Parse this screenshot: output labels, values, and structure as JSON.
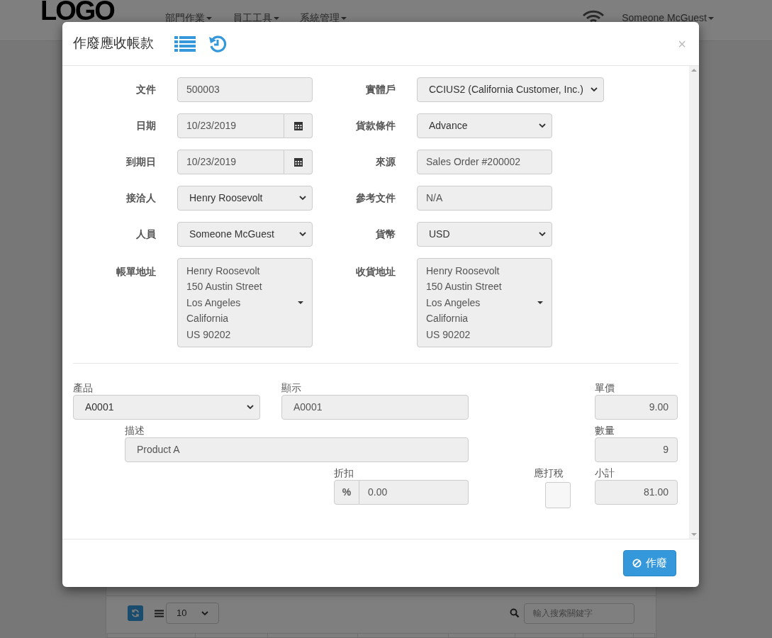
{
  "page": {
    "logo": "LOGO",
    "menu": [
      {
        "label": "部門作業"
      },
      {
        "label": "員工工具"
      },
      {
        "label": "系統管理"
      }
    ],
    "user": "Someone McGuest",
    "toolbar": {
      "page_size": "10",
      "search_placeholder": "輸入搜索關鍵字"
    }
  },
  "modal": {
    "title": "作廢應收帳款",
    "left_fields": [
      {
        "label": "文件",
        "kind": "text",
        "value": "500003"
      },
      {
        "label": "日期",
        "kind": "date",
        "value": "10/23/2019"
      },
      {
        "label": "到期日",
        "kind": "date",
        "value": "10/23/2019"
      },
      {
        "label": "接洽人",
        "kind": "select",
        "value": "Henry Roosevolt"
      },
      {
        "label": "人員",
        "kind": "select",
        "value": "Someone McGuest"
      },
      {
        "label": "帳單地址",
        "kind": "address",
        "lines": [
          "Henry Roosevolt",
          "150 Austin Street",
          "Los Angeles",
          "California",
          "US 90202"
        ]
      }
    ],
    "right_fields": [
      {
        "label": "實體戶",
        "kind": "select",
        "value": "CCIUS2 (California Customer, Inc.)"
      },
      {
        "label": "貨款條件",
        "kind": "select",
        "value": "Advance"
      },
      {
        "label": "來源",
        "kind": "text",
        "value": "Sales Order #200002"
      },
      {
        "label": "參考文件",
        "kind": "text",
        "value": "N/A"
      },
      {
        "label": "貨幣",
        "kind": "select",
        "value": "USD"
      },
      {
        "label": "收貨地址",
        "kind": "address",
        "lines": [
          "Henry Roosevolt",
          "150 Austin Street",
          "Los Angeles",
          "California",
          "US 90202"
        ]
      }
    ],
    "line_item": {
      "product": {
        "label": "產品",
        "value": "A0001"
      },
      "display": {
        "label": "顯示",
        "value": "A0001"
      },
      "unit_price": {
        "label": "單價",
        "value": "9.00"
      },
      "description": {
        "label": "描述",
        "value": "Product A"
      },
      "quantity": {
        "label": "數量",
        "value": "9"
      },
      "discount": {
        "label": "折扣",
        "unit": "%",
        "value": "0.00"
      },
      "taxable": {
        "label": "應打稅",
        "checked": false
      },
      "subtotal": {
        "label": "小計",
        "value": "81.00"
      }
    },
    "close_glyph": "×",
    "void_button": "作廢"
  }
}
